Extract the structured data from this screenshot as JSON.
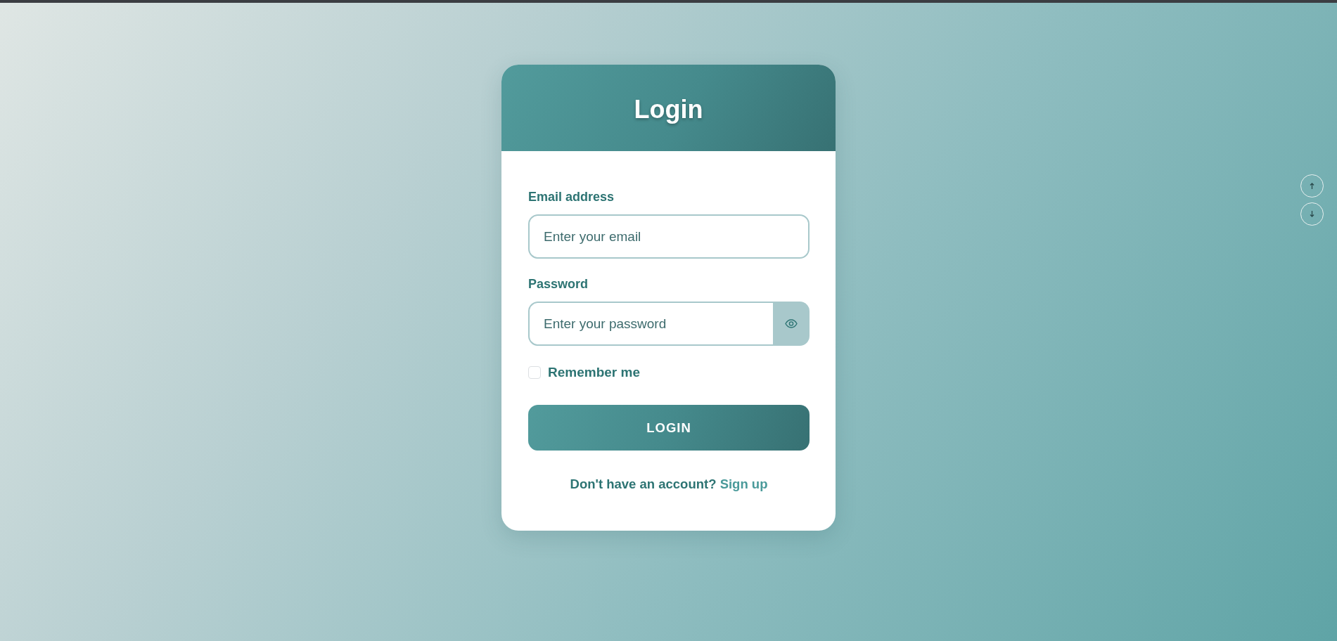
{
  "header": {
    "title": "Login"
  },
  "fields": [
    {
      "kind": "text",
      "label": "Email address",
      "placeholder": "Enter your email"
    },
    {
      "kind": "password",
      "label": "Password",
      "placeholder": "Enter your password"
    }
  ],
  "remember": {
    "label": "Remember me",
    "checked": false
  },
  "submit": {
    "label": "LOGIN"
  },
  "signup": {
    "text": "Don't have an account?",
    "link": "Sign up"
  }
}
